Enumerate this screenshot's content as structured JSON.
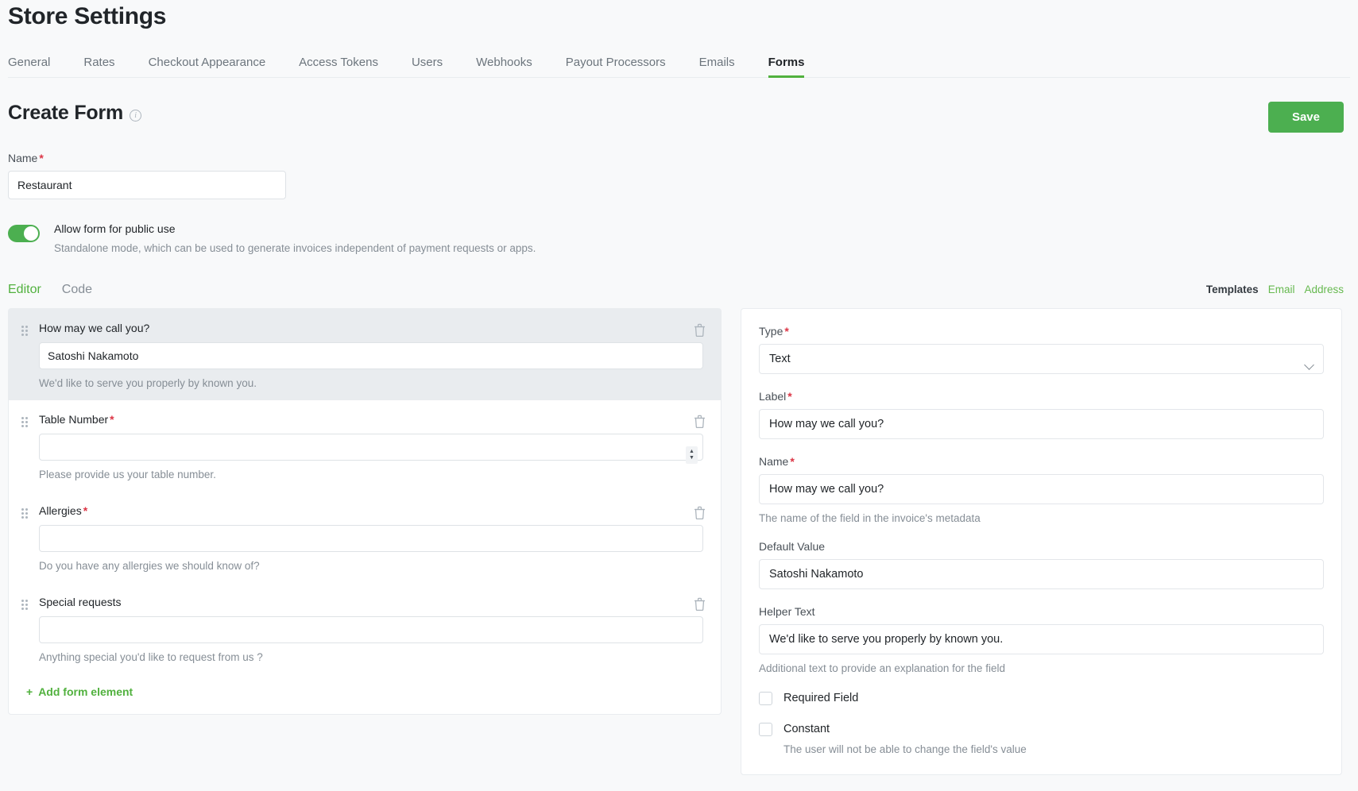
{
  "header": {
    "title": "Store Settings",
    "tabs": [
      {
        "label": "General",
        "active": false
      },
      {
        "label": "Rates",
        "active": false
      },
      {
        "label": "Checkout Appearance",
        "active": false
      },
      {
        "label": "Access Tokens",
        "active": false
      },
      {
        "label": "Users",
        "active": false
      },
      {
        "label": "Webhooks",
        "active": false
      },
      {
        "label": "Payout Processors",
        "active": false
      },
      {
        "label": "Emails",
        "active": false
      },
      {
        "label": "Forms",
        "active": true
      }
    ]
  },
  "form_section": {
    "title": "Create Form",
    "info_icon": "info-icon",
    "save_label": "Save",
    "name_label": "Name",
    "name_required_mark": "*",
    "name_value": "Restaurant",
    "toggle": {
      "enabled": true,
      "title": "Allow form for public use",
      "description": "Standalone mode, which can be used to generate invoices independent of payment requests or apps."
    }
  },
  "editor_bar": {
    "tabs": [
      {
        "label": "Editor",
        "active": true
      },
      {
        "label": "Code",
        "active": false
      }
    ],
    "templates_label": "Templates",
    "template_links": [
      "Email",
      "Address"
    ]
  },
  "editor": {
    "elements": [
      {
        "label": "How may we call you?",
        "required": false,
        "value": "Satoshi Nakamoto",
        "placeholder": "",
        "help": "We'd like to serve you properly by known you.",
        "selected": true,
        "input_type": "text"
      },
      {
        "label": "Table Number",
        "required": true,
        "value": "",
        "placeholder": "",
        "help": "Please provide us your table number.",
        "selected": false,
        "input_type": "number"
      },
      {
        "label": "Allergies",
        "required": true,
        "value": "",
        "placeholder": "",
        "help": "Do you have any allergies we should know of?",
        "selected": false,
        "input_type": "text"
      },
      {
        "label": "Special requests",
        "required": false,
        "value": "",
        "placeholder": "",
        "help": "Anything special you'd like to request from us ?",
        "selected": false,
        "input_type": "text"
      }
    ],
    "add_element_label": "Add form element",
    "add_element_plus": "+",
    "delete_icon": "trash-icon",
    "drag_icon": "drag-handle-icon"
  },
  "properties": {
    "type_label": "Type",
    "type_value": "Text",
    "label_label": "Label",
    "label_value": "How may we call you?",
    "name_label": "Name",
    "name_value": "How may we call you?",
    "name_help": "The name of the field in the invoice's metadata",
    "default_value_label": "Default Value",
    "default_value": "Satoshi Nakamoto",
    "helper_text_label": "Helper Text",
    "helper_text_value": "We'd like to serve you properly by known you.",
    "helper_text_help": "Additional text to provide an explanation for the field",
    "required_field_label": "Required Field",
    "required_field_checked": false,
    "constant_label": "Constant",
    "constant_checked": false,
    "constant_help": "The user will not be able to change the field's value",
    "required_mark": "*"
  },
  "colors": {
    "accent_green": "#51b13e",
    "save_green": "#4caf50",
    "required_red": "#dc3545",
    "muted_text": "#868e96",
    "page_bg": "#f8f9fa"
  }
}
